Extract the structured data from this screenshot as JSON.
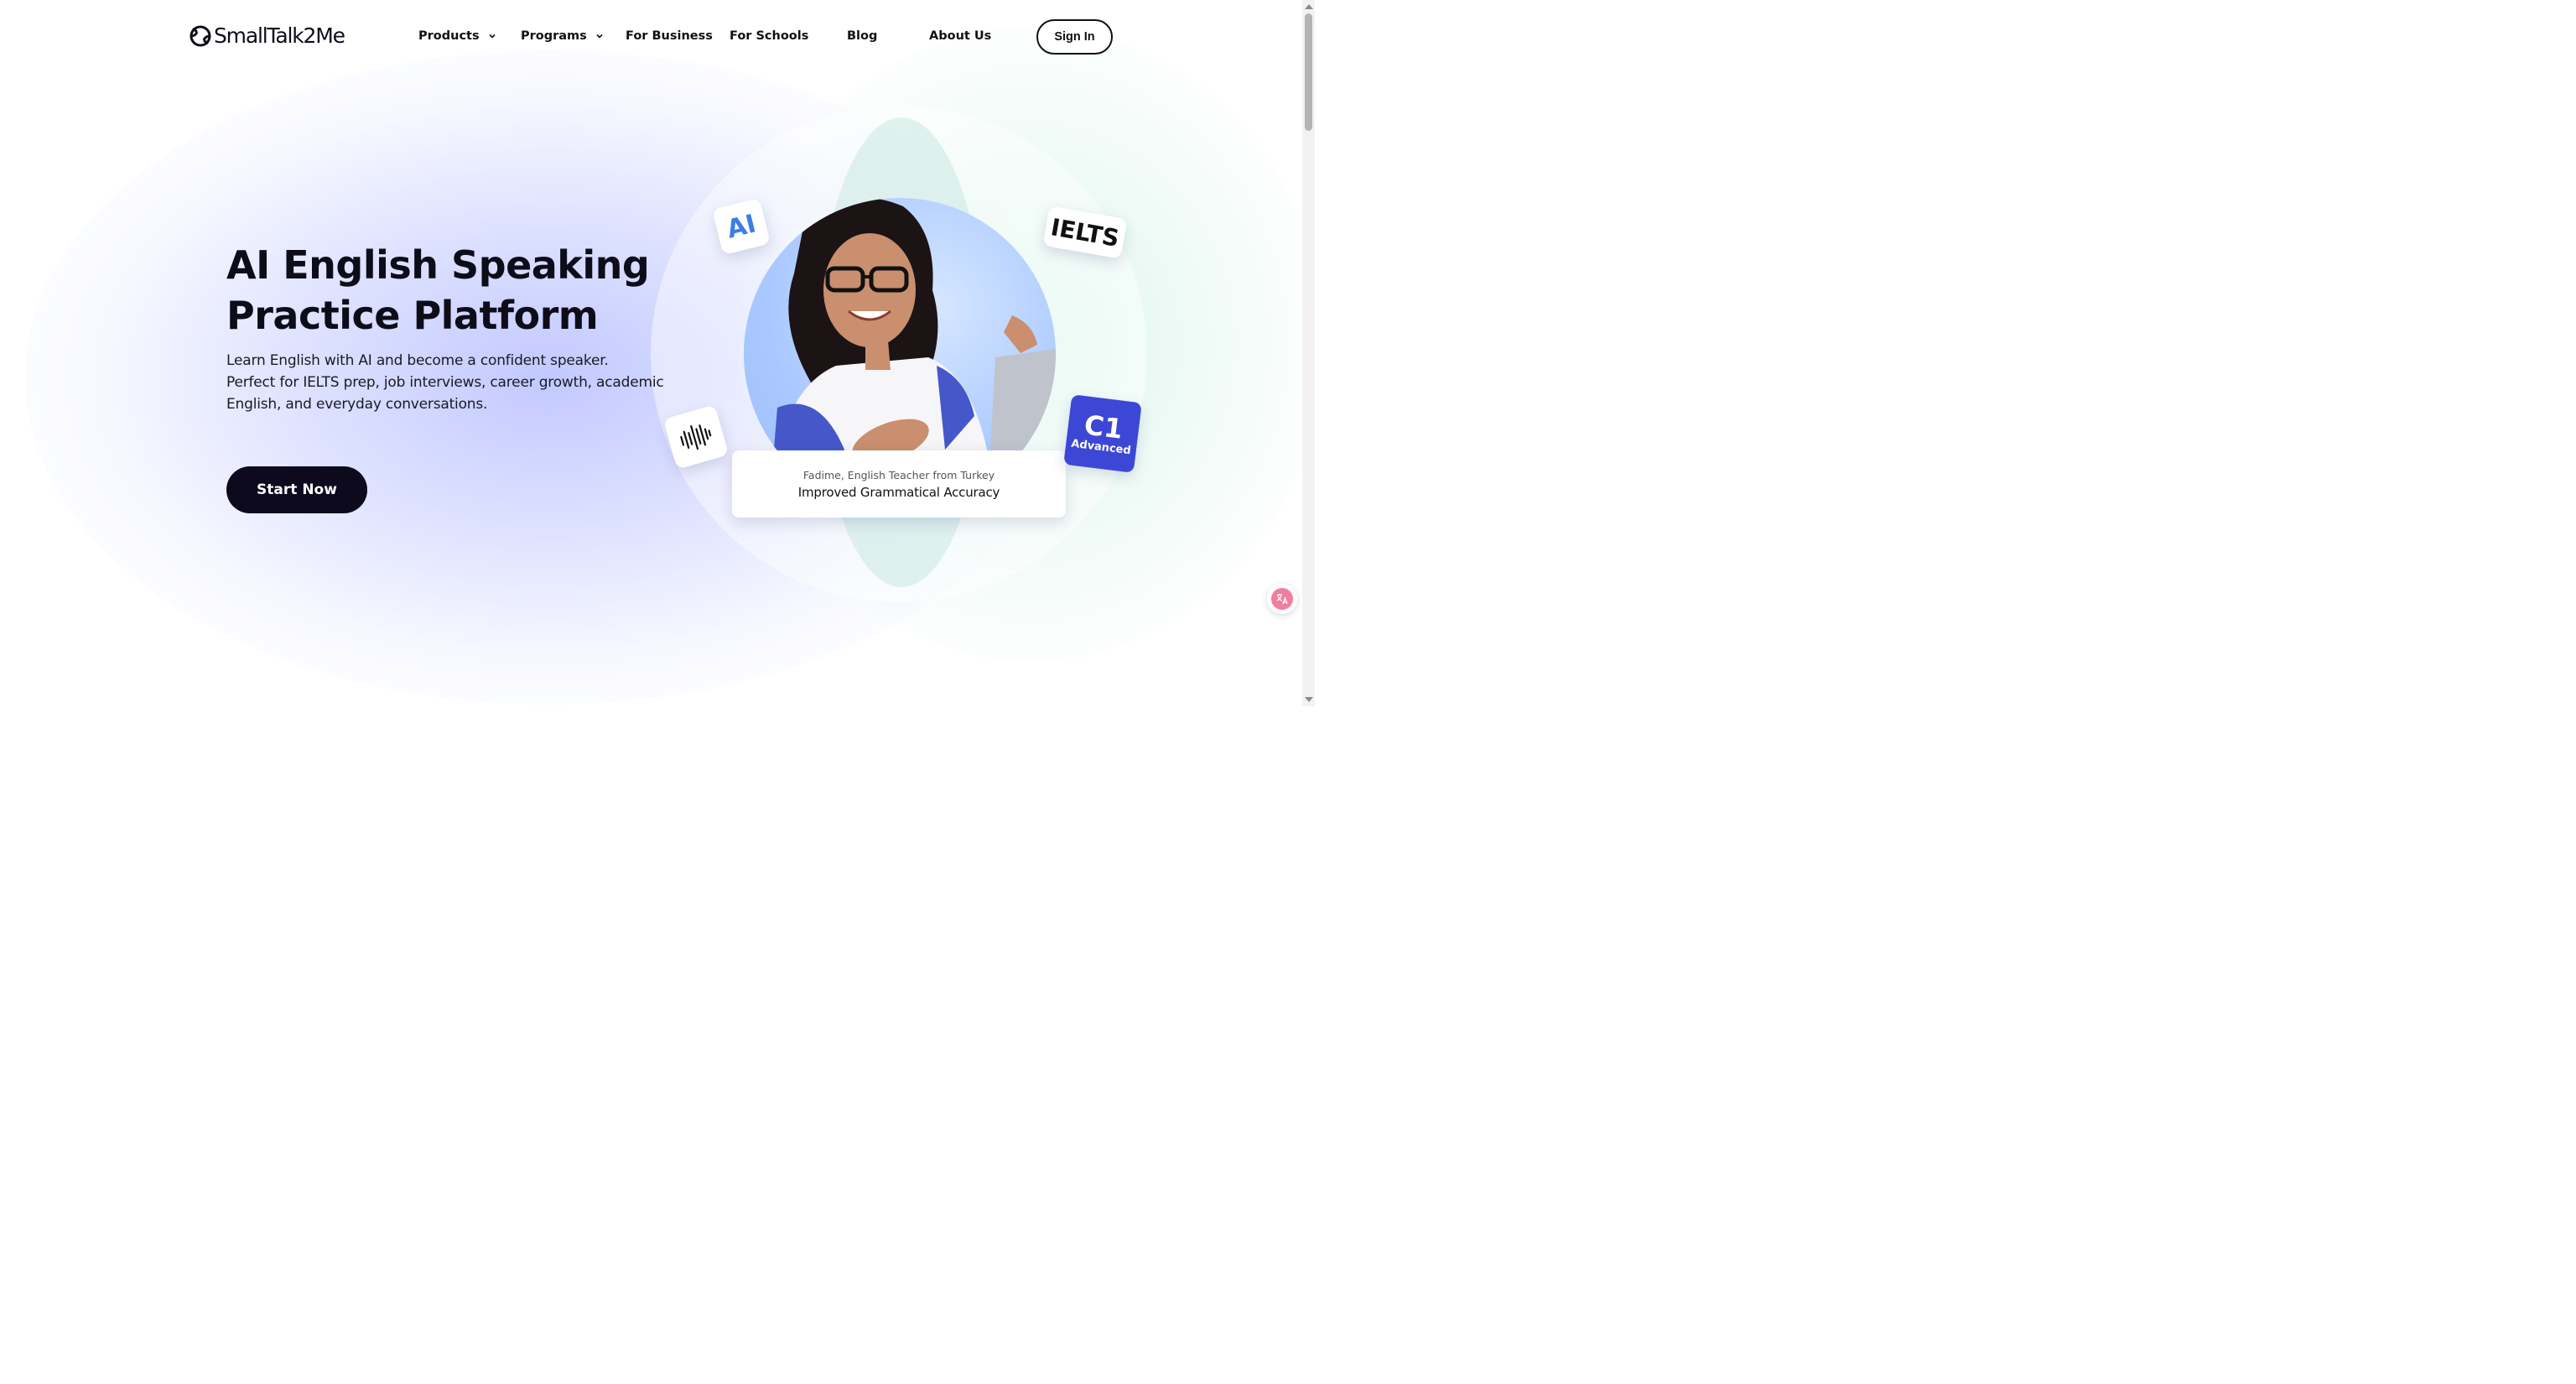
{
  "brand": {
    "name": "SmallTalk2Me",
    "logo_icon": "smalltalk2me-logo-icon"
  },
  "nav": {
    "items": [
      {
        "label": "Products",
        "has_dropdown": true
      },
      {
        "label": "Programs",
        "has_dropdown": true
      },
      {
        "label": "For Business",
        "has_dropdown": false
      },
      {
        "label": "For Schools",
        "has_dropdown": false
      },
      {
        "label": "Blog",
        "has_dropdown": false
      },
      {
        "label": "About Us",
        "has_dropdown": false
      }
    ],
    "sign_in_label": "Sign In"
  },
  "hero": {
    "title_line1": "AI English Speaking",
    "title_line2": "Practice Platform",
    "desc_line1": "Learn English with AI and become a confident speaker.",
    "desc_line2": "Perfect for IELTS prep, job interviews, career growth, academic English, and everyday conversations.",
    "cta_label": "Start Now"
  },
  "testimonial": {
    "person": "Fadime, English Teacher from Turkey",
    "result": "Improved Grammatical Accuracy"
  },
  "tags": {
    "ai": "AI",
    "ielts": "IELTS",
    "level_code": "C1",
    "level_name": "Advanced",
    "voice_icon": "sound-wave-icon"
  },
  "colors": {
    "primary_dark": "#0c0a1c",
    "ai_blue": "#3b7ee8",
    "level_badge": "#3d47d6",
    "hero_glow": "#c8cdff"
  },
  "translate_widget": {
    "icon": "translate-icon"
  }
}
